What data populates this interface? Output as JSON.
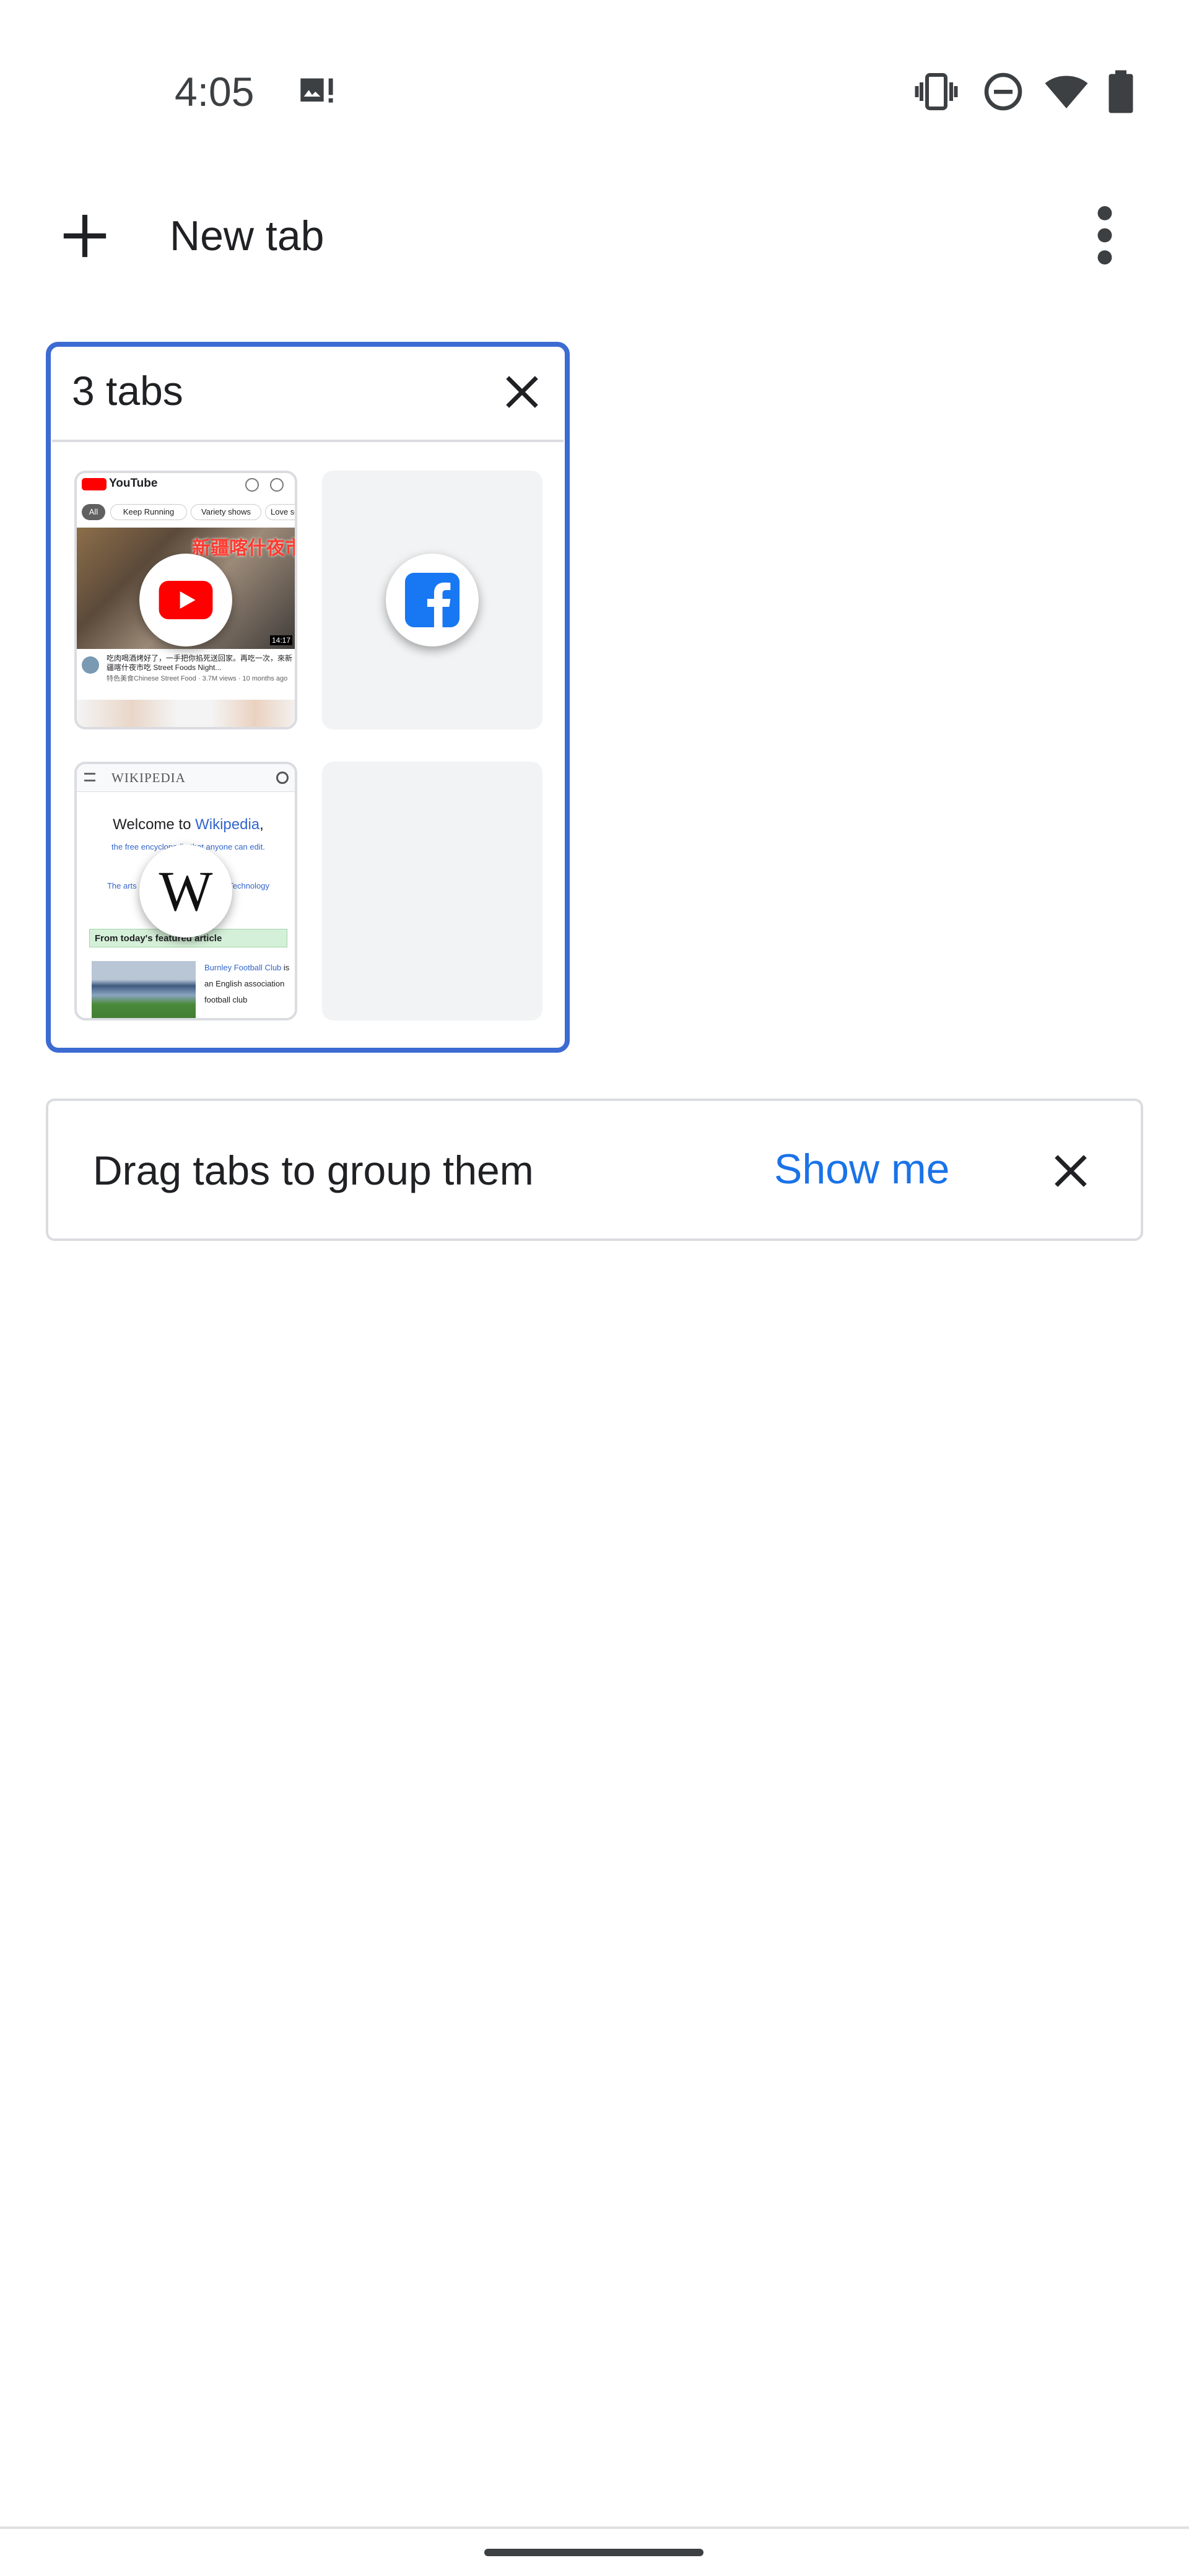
{
  "status_bar": {
    "time": "4:05",
    "notification_icon": "image-alert-icon",
    "icons": [
      "vibrate-icon",
      "do-not-disturb-icon",
      "wifi-icon",
      "battery-icon"
    ]
  },
  "toolbar": {
    "new_tab_label": "New tab",
    "new_tab_icon": "plus-icon",
    "menu_icon": "more-vert-icon"
  },
  "tab_group": {
    "title": "3 tabs",
    "accent_color": "#3c6bd2",
    "tabs": [
      {
        "favicon": "youtube-icon",
        "thumbnail": {
          "brand": "YouTube",
          "chips": [
            "All",
            "Keep Running",
            "Variety shows",
            "Love song"
          ],
          "banner": "新疆喀什夜市",
          "duration": "14:17",
          "video_title": "吃肉喝酒烤好了，一手把你掐死送回家。再吃一次，來新疆喀什夜市吃 Street Foods Night...",
          "video_meta": "特色美食Chinese Street Food · 3.7M views · 10 months ago"
        }
      },
      {
        "favicon": "facebook-icon",
        "thumbnail": null
      },
      {
        "favicon": "wikipedia-icon",
        "thumbnail": {
          "brand": "WIKIPEDIA",
          "welcome_prefix": "Welcome to ",
          "welcome_link": "Wikipedia",
          "intro_line1": "the free encyclopedia that anyone can edit.",
          "intro_line2": "The arts · History · Mathematics · Technology",
          "featured_header": "From today's featured article",
          "featured_link": "Burnley Football Club",
          "featured_text": " is an English association football club"
        }
      }
    ]
  },
  "promo": {
    "message": "Drag tabs to group them",
    "action_label": "Show me",
    "action_color": "#1a73e8"
  }
}
